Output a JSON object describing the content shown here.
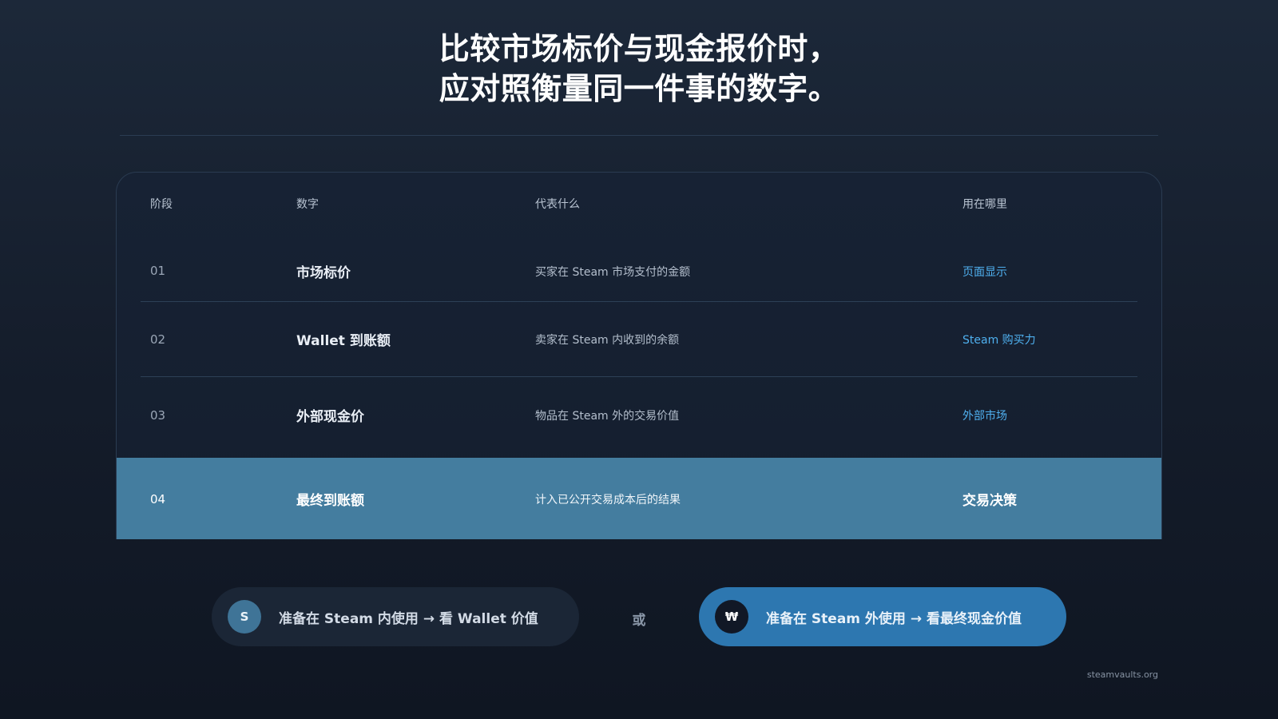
{
  "title": {
    "line1": "比较市场标价与现金报价时，",
    "line2": "应对照衡量同一件事的数字。"
  },
  "table": {
    "headers": [
      "阶段",
      "数字",
      "代表什么",
      "用在哪里"
    ],
    "rows": [
      [
        "01",
        "市场标价",
        "买家在 Steam 市场支付的金额",
        "页面显示"
      ],
      [
        "02",
        "Wallet 到账额",
        "卖家在 Steam 内收到的余额",
        "Steam 购买力"
      ],
      [
        "03",
        "外部现金价",
        "物品在 Steam 外的交易价值",
        "外部市场"
      ],
      [
        "04",
        "最终到账额",
        "计入已公开交易成本后的结果",
        "交易决策"
      ]
    ],
    "highlighted_row": "04"
  },
  "options": {
    "left": {
      "badge": "S",
      "text": "准备在 Steam 内使用 → 看 Wallet 价值"
    },
    "separator": "或",
    "right": {
      "badge": "₩",
      "text": "准备在 Steam 外使用 → 看最终现金价值"
    }
  },
  "footer": {
    "site": "steamvaults.org"
  },
  "colors": {
    "accent_link": "#4fb0ef",
    "highlight_row": "#447d9f",
    "primary_pill": "#2d77b0"
  }
}
